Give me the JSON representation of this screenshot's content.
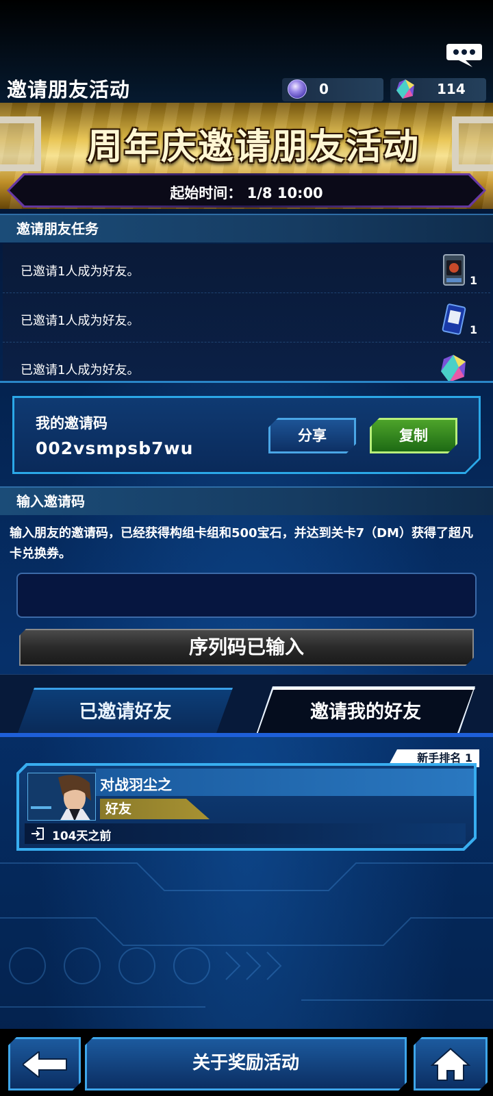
{
  "header": {
    "title": "邀请朋友活动",
    "orb_count": "0",
    "gem_count": "114"
  },
  "banner": {
    "title": "周年庆邀请朋友活动",
    "start_time": "起始时间： 1/8 10:00"
  },
  "missions": {
    "header": "邀请朋友任务",
    "items": [
      {
        "text": "已邀请1人成为好友。",
        "reward_icon": "card-pack-icon",
        "qty": "1"
      },
      {
        "text": "已邀请1人成为好友。",
        "reward_icon": "ticket-card-icon",
        "qty": "1"
      },
      {
        "text": "已邀请1人成为好友。",
        "reward_icon": "gem-icon",
        "qty": ""
      }
    ]
  },
  "my_code": {
    "label": "我的邀请码",
    "value": "002vsmpsb7wu",
    "share_label": "分享",
    "copy_label": "复制"
  },
  "enter_code": {
    "header": "输入邀请码",
    "description": "输入朋友的邀请码，已经获得构组卡组和500宝石，并达到关卡7（DM）获得了超凡卡兑换券。",
    "input_value": "",
    "button_label": "序列码已输入"
  },
  "tabs": {
    "invited_label": "已邀请好友",
    "inviter_label": "邀请我的好友",
    "selected": "inviter"
  },
  "friend": {
    "rank_label": "新手排名 1",
    "name": "对战羽尘之",
    "tag": "好友",
    "last_login": "104天之前"
  },
  "bottom_nav": {
    "about_label": "关于奖励活动"
  },
  "colors": {
    "accent_blue": "#2ba8e8",
    "copy_green": "#4da32a",
    "banner_gold": "#e8c24a"
  }
}
